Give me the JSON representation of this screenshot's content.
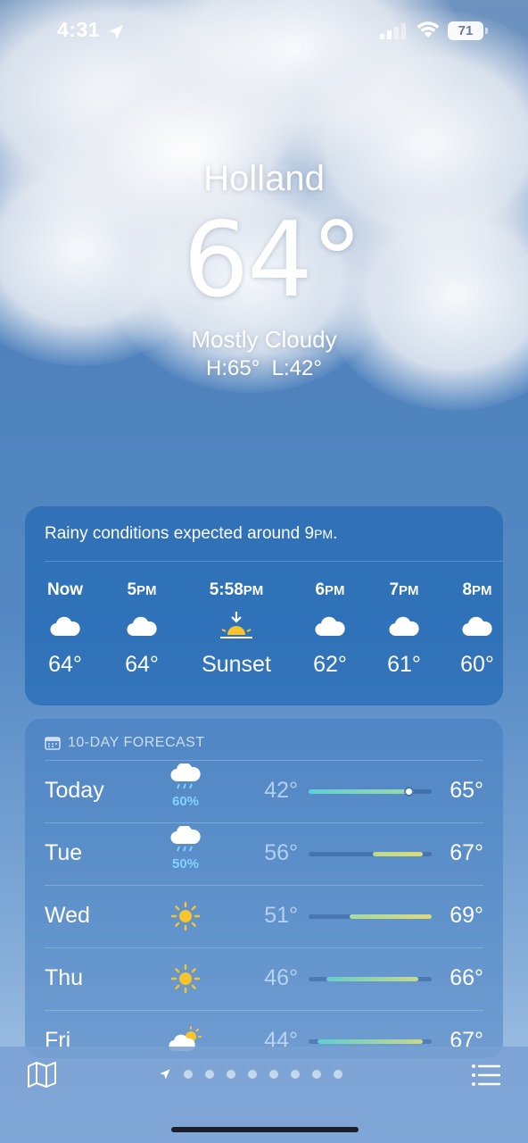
{
  "status_bar": {
    "time": "4:31",
    "battery": "71"
  },
  "header": {
    "city": "Holland",
    "temperature": "64°",
    "condition": "Mostly Cloudy",
    "hi_lo": "H:65°  L:42°"
  },
  "hourly": {
    "note_prefix": "Rainy conditions expected around 9",
    "note_suffix": "PM",
    "note_end": ".",
    "items": [
      {
        "time": "Now",
        "suffix": "",
        "icon": "cloud-icon",
        "value": "64°"
      },
      {
        "time": "5",
        "suffix": "PM",
        "icon": "cloud-icon",
        "value": "64°"
      },
      {
        "time": "5:58",
        "suffix": "PM",
        "icon": "sunset-icon",
        "value": "Sunset"
      },
      {
        "time": "6",
        "suffix": "PM",
        "icon": "cloud-icon",
        "value": "62°"
      },
      {
        "time": "7",
        "suffix": "PM",
        "icon": "cloud-icon",
        "value": "61°"
      },
      {
        "time": "8",
        "suffix": "PM",
        "icon": "cloud-icon",
        "value": "60°"
      }
    ]
  },
  "forecast": {
    "title": "10-DAY FORECAST",
    "range": {
      "min": 42,
      "max": 69
    },
    "days": [
      {
        "day": "Today",
        "icon": "rain-cloud-icon",
        "precip": "60%",
        "low": "42°",
        "high": "65°",
        "low_v": 42,
        "high_v": 65,
        "current_v": 64,
        "color_from": "#5fd0d6",
        "color_to": "#9ed7a8"
      },
      {
        "day": "Tue",
        "icon": "rain-cloud-icon",
        "precip": "50%",
        "low": "56°",
        "high": "67°",
        "low_v": 56,
        "high_v": 67,
        "color_from": "#bcd98a",
        "color_to": "#d9dc7a"
      },
      {
        "day": "Wed",
        "icon": "sun-icon",
        "precip": "",
        "low": "51°",
        "high": "69°",
        "low_v": 51,
        "high_v": 69,
        "color_from": "#a7d9a0",
        "color_to": "#e0d977"
      },
      {
        "day": "Thu",
        "icon": "sun-icon",
        "precip": "",
        "low": "46°",
        "high": "66°",
        "low_v": 46,
        "high_v": 66,
        "color_from": "#66cfc9",
        "color_to": "#c3d88c"
      },
      {
        "day": "Fri",
        "icon": "partly-sunny-icon",
        "precip": "",
        "low": "44°",
        "high": "67°",
        "low_v": 44,
        "high_v": 67,
        "color_from": "#5fcfd0",
        "color_to": "#c9d88a"
      }
    ]
  },
  "bottom_bar": {
    "page_count": 9,
    "active_page": 0
  },
  "colors": {
    "accent_precip": "#7fd3ff",
    "sun_yellow": "#f7c52b"
  }
}
